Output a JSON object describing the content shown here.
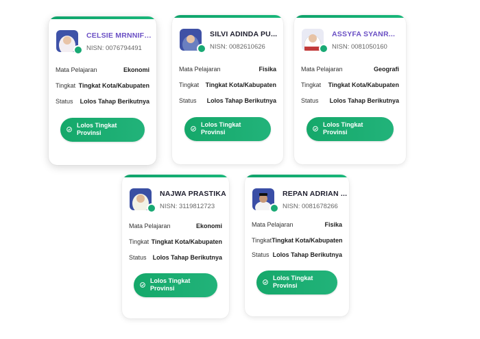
{
  "labels": {
    "subject": "Mata Pelajaran",
    "level": "Tingkat",
    "status": "Status",
    "nisn_prefix": "NISN:"
  },
  "students": [
    {
      "name": "CELSIE MRNNIFL...",
      "nisn": "NISN: 0076794491",
      "subject": "Ekonomi",
      "level": "Tingkat Kota/Kabupaten",
      "status": "Lolos Tahap Berikutnya",
      "button": "Lolos Tingkat Provinsi"
    },
    {
      "name": "SILVI ADINDA PU...",
      "nisn": "NISN: 0082610626",
      "subject": "Fisika",
      "level": "Tingkat Kota/Kabupaten",
      "status": "Lolos Tahap Berikutnya",
      "button": "Lolos Tingkat Provinsi"
    },
    {
      "name": "ASSYFA SYANR...",
      "nisn": "NISN: 0081050160",
      "subject": "Geografi",
      "level": "Tingkat Kota/Kabupaten",
      "status": "Lolos Tahap Berikutnya",
      "button": "Lolos Tingkat Provinsi"
    },
    {
      "name": "NAJWA PRASTIKA",
      "nisn": "NISN: 3119812723",
      "subject": "Ekonomi",
      "level": "Tingkat Kota/Kabupaten",
      "status": "Lolos Tahap Berikutnya",
      "button": "Lolos Tingkat Provinsi"
    },
    {
      "name": "REPAN ADRIAN ...",
      "nisn": "NISN: 0081678266",
      "subject": "Fisika",
      "level": "Tingkat Kota/Kabupaten",
      "status": "Lolos Tahap Berikutnya",
      "button": "Lolos Tingkat Provinsi"
    }
  ],
  "colors": {
    "accent_green": "#15a86a",
    "name_purple": "#6a4fc4",
    "name_dark": "#1e1e2e"
  }
}
